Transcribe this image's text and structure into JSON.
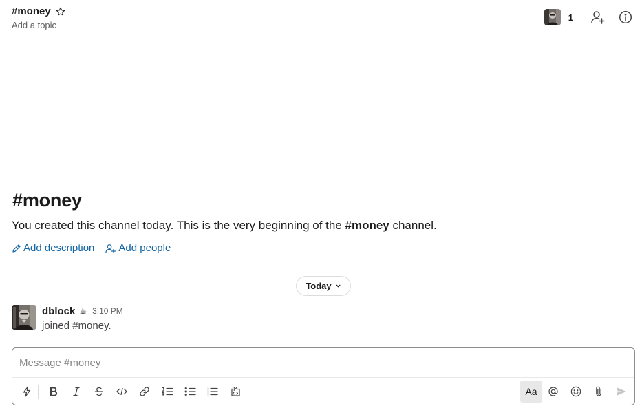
{
  "header": {
    "channel_name": "#money",
    "topic_placeholder": "Add a topic",
    "member_count": "1",
    "icons": [
      "star-icon",
      "add-member-icon",
      "info-icon"
    ]
  },
  "intro": {
    "title": "#money",
    "text_before": "You created this channel today. This is the very beginning of the ",
    "text_channel": "#money",
    "text_after": " channel.",
    "add_description_label": "Add description",
    "add_people_label": "Add people"
  },
  "divider": {
    "label": "Today"
  },
  "message": {
    "user": "dblock",
    "status_emoji": "☕",
    "time": "3:10 PM",
    "text": "joined #money."
  },
  "composer": {
    "placeholder": "Message #money",
    "value": "",
    "format_button_label": "Aa"
  },
  "colors": {
    "link": "#1264a3",
    "text": "#1d1c1d",
    "muted": "#616061"
  }
}
